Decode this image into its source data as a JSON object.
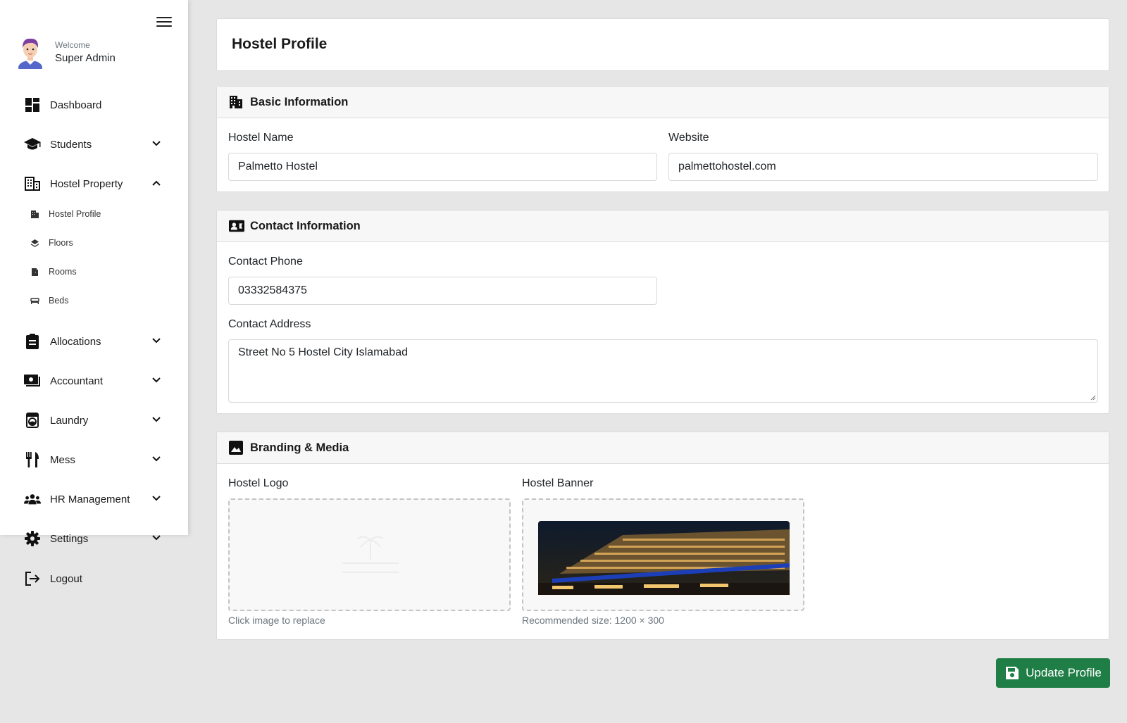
{
  "sidebar": {
    "welcome": "Welcome",
    "user_name": "Super Admin",
    "items": [
      {
        "label": "Dashboard",
        "icon": "dashboard-icon"
      },
      {
        "label": "Students",
        "icon": "graduation-cap-icon"
      },
      {
        "label": "Hostel Property",
        "icon": "building-icon"
      },
      {
        "label": "Allocations",
        "icon": "clipboard-icon"
      },
      {
        "label": "Accountant",
        "icon": "money-icon"
      },
      {
        "label": "Laundry",
        "icon": "washing-machine-icon"
      },
      {
        "label": "Mess",
        "icon": "utensils-icon"
      },
      {
        "label": "HR Management",
        "icon": "users-icon"
      },
      {
        "label": "Settings",
        "icon": "gear-icon"
      },
      {
        "label": "Logout",
        "icon": "logout-icon"
      }
    ],
    "sub_items": [
      {
        "label": "Hostel Profile",
        "icon": "building-icon"
      },
      {
        "label": "Floors",
        "icon": "layers-icon"
      },
      {
        "label": "Rooms",
        "icon": "door-icon"
      },
      {
        "label": "Beds",
        "icon": "bed-icon"
      }
    ]
  },
  "page": {
    "title": "Hostel Profile"
  },
  "basic": {
    "heading": "Basic Information",
    "name_label": "Hostel Name",
    "name_value": "Palmetto Hostel",
    "website_label": "Website",
    "website_value": "palmettohostel.com"
  },
  "contact": {
    "heading": "Contact Information",
    "phone_label": "Contact Phone",
    "phone_value": "03332584375",
    "address_label": "Contact Address",
    "address_value": "Street No 5 Hostel City Islamabad"
  },
  "branding": {
    "heading": "Branding & Media",
    "logo_label": "Hostel Logo",
    "logo_hint": "Click image to replace",
    "banner_label": "Hostel Banner",
    "banner_hint": "Recommended size: 1200 × 300"
  },
  "actions": {
    "update_label": "Update Profile"
  },
  "colors": {
    "primary_button": "#1e7e45",
    "sidebar_bg": "#ffffff",
    "page_bg": "#e6e6e6"
  }
}
